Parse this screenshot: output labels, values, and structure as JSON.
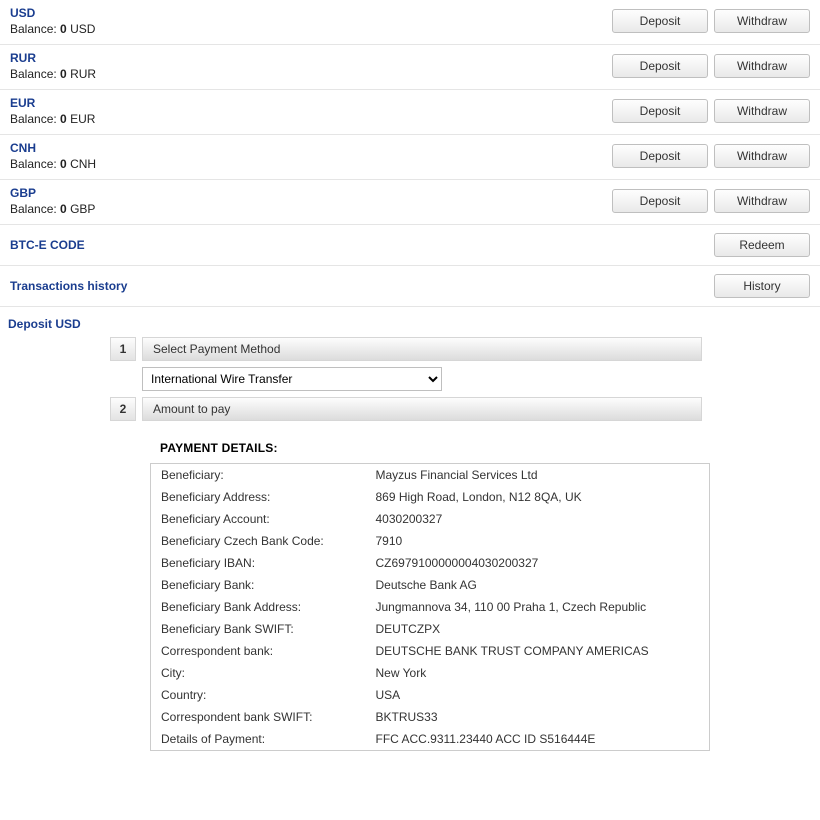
{
  "currencies": [
    {
      "code": "USD",
      "balance_label": "Balance:",
      "value": "0",
      "unit": "USD",
      "deposit": "Deposit",
      "withdraw": "Withdraw"
    },
    {
      "code": "RUR",
      "balance_label": "Balance:",
      "value": "0",
      "unit": "RUR",
      "deposit": "Deposit",
      "withdraw": "Withdraw"
    },
    {
      "code": "EUR",
      "balance_label": "Balance:",
      "value": "0",
      "unit": "EUR",
      "deposit": "Deposit",
      "withdraw": "Withdraw"
    },
    {
      "code": "CNH",
      "balance_label": "Balance:",
      "value": "0",
      "unit": "CNH",
      "deposit": "Deposit",
      "withdraw": "Withdraw"
    },
    {
      "code": "GBP",
      "balance_label": "Balance:",
      "value": "0",
      "unit": "GBP",
      "deposit": "Deposit",
      "withdraw": "Withdraw"
    }
  ],
  "btce_code": {
    "title": "BTC-E CODE",
    "redeem": "Redeem"
  },
  "history": {
    "title": "Transactions history",
    "button": "History"
  },
  "deposit": {
    "heading": "Deposit USD",
    "step1": {
      "num": "1",
      "label": "Select Payment Method"
    },
    "method_selected": "International Wire Transfer",
    "step2": {
      "num": "2",
      "label": "Amount to pay"
    },
    "details_heading": "PAYMENT DETAILS:",
    "rows": [
      {
        "k": "Beneficiary:",
        "v": "Mayzus Financial Services Ltd"
      },
      {
        "k": "Beneficiary Address:",
        "v": "869 High Road, London, N12 8QA, UK"
      },
      {
        "k": "Beneficiary Account:",
        "v": "4030200327"
      },
      {
        "k": "Beneficiary Czech Bank Code:",
        "v": "7910"
      },
      {
        "k": "Beneficiary IBAN:",
        "v": "CZ6979100000004030200327"
      },
      {
        "k": "Beneficiary Bank:",
        "v": "Deutsche Bank AG"
      },
      {
        "k": "Beneficiary Bank Address:",
        "v": "Jungmannova 34, 110 00 Praha 1, Czech Republic"
      },
      {
        "k": "Beneficiary Bank SWIFT:",
        "v": "DEUTCZPX"
      },
      {
        "k": "Correspondent bank:",
        "v": "DEUTSCHE BANK TRUST COMPANY AMERICAS"
      },
      {
        "k": "City:",
        "v": "New York"
      },
      {
        "k": "Country:",
        "v": "USA"
      },
      {
        "k": "Correspondent bank SWIFT:",
        "v": "BKTRUS33"
      },
      {
        "k": "Details of Payment:",
        "v": "FFC ACC.9311.23440 ACC ID S516444E"
      }
    ]
  }
}
